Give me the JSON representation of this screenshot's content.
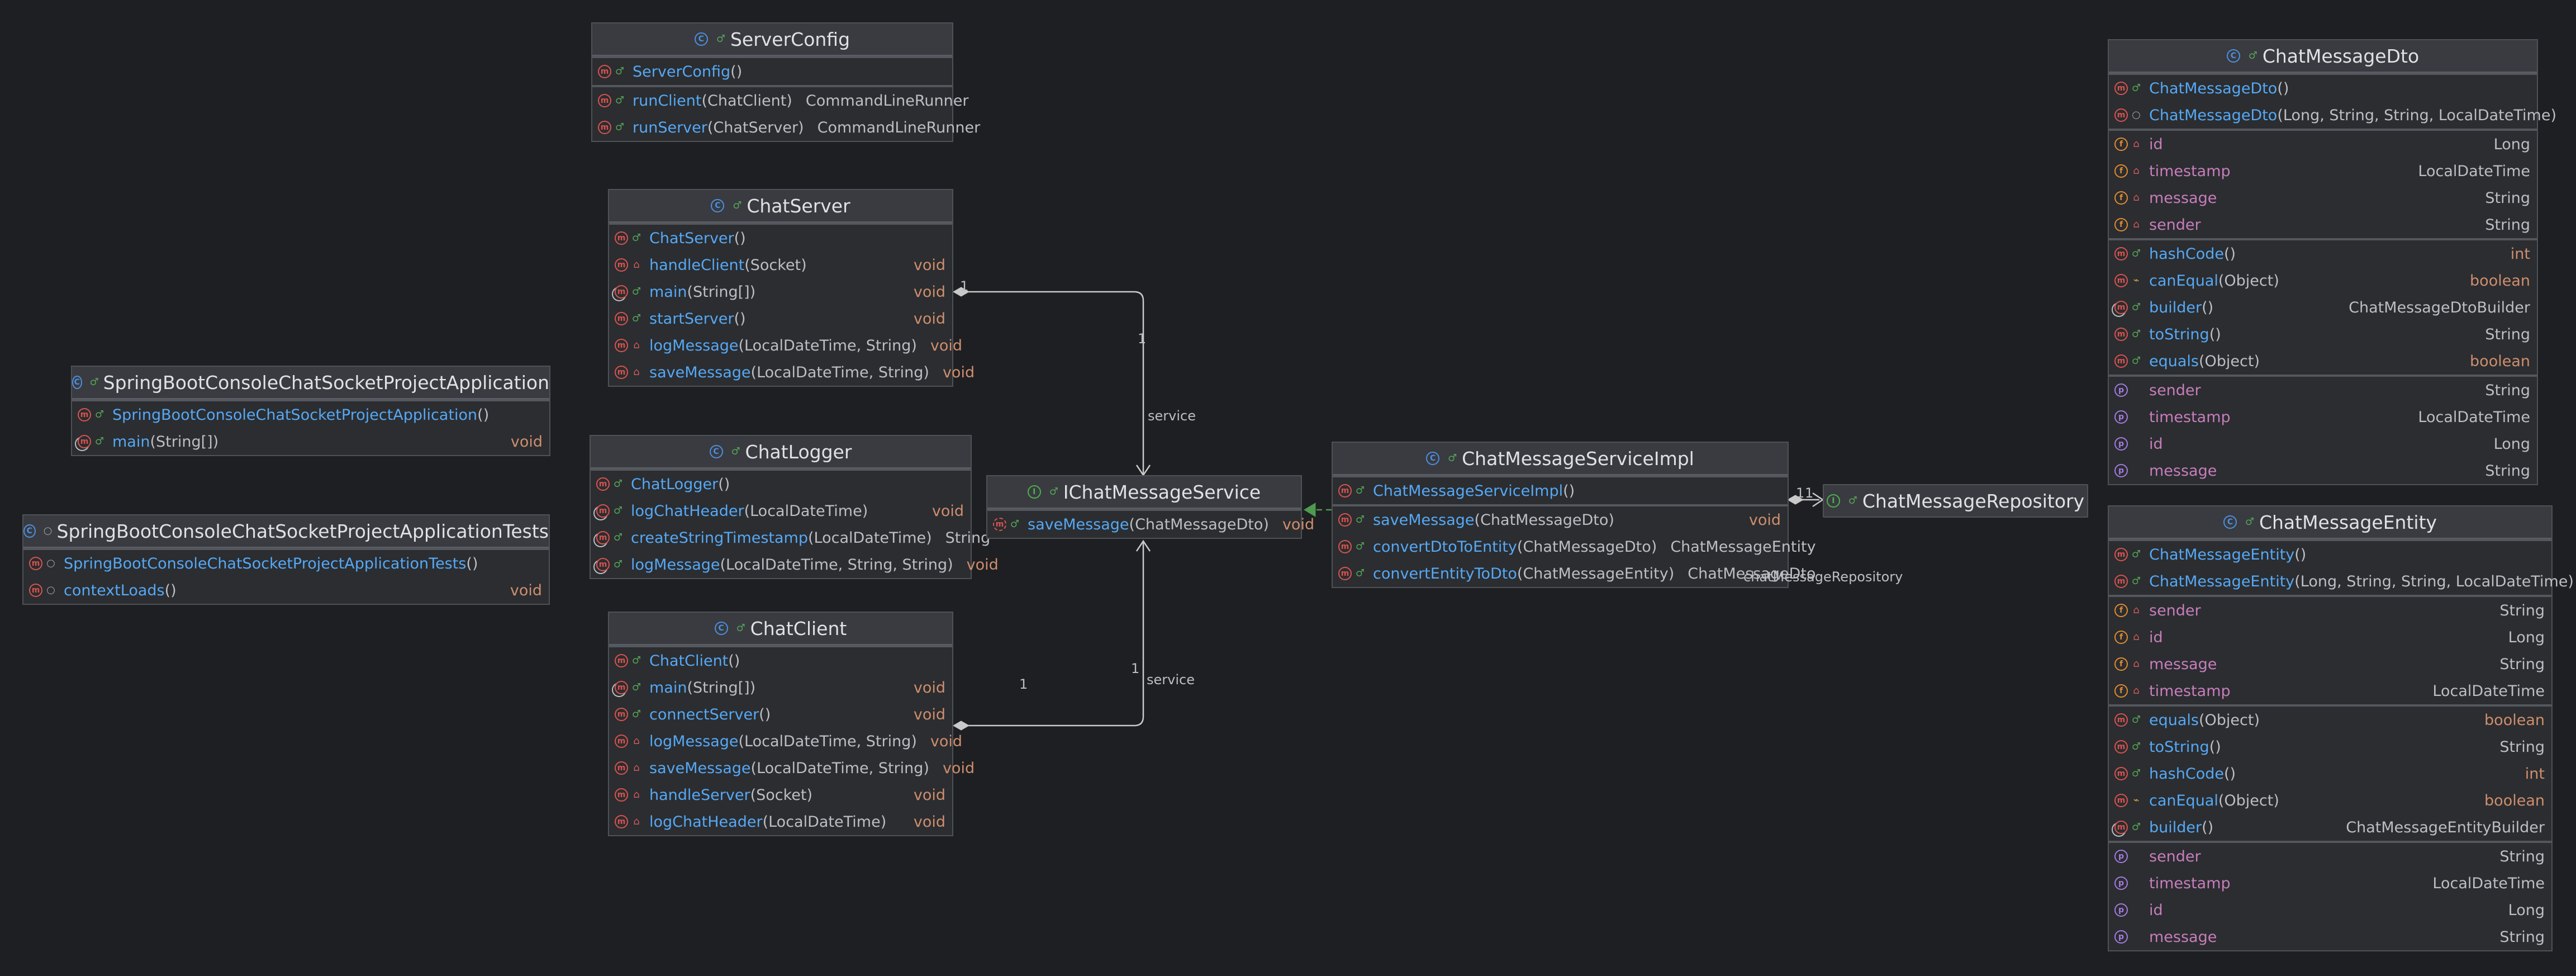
{
  "colors": {
    "background": "#1e1f22",
    "node_body": "#2b2d30",
    "node_header": "#393b40",
    "method_name": "#56a8f5",
    "field_name": "#c77dbb",
    "keyword_type": "#cf8e6d",
    "edge": "#c9c9c9",
    "realization_edge": "#4e9a4e"
  },
  "icons": {
    "class": "class-icon",
    "interface": "interface-icon",
    "method": "method-icon",
    "field": "field-icon",
    "property": "property-icon",
    "public": "unlock-icon",
    "private": "lock-icon",
    "package_private": "circle-icon",
    "protected": "key-icon",
    "static": "static-overlay-icon"
  },
  "nodes": [
    {
      "id": "server-config",
      "title": "ServerConfig",
      "kind": "class",
      "sections": [
        [
          {
            "icon": "method",
            "name": "ServerConfig",
            "params": "()",
            "type": ""
          }
        ],
        [
          {
            "icon": "method",
            "name": "runClient",
            "params": "(ChatClient)",
            "type": "CommandLineRunner"
          },
          {
            "icon": "method",
            "name": "runServer",
            "params": "(ChatServer)",
            "type": "CommandLineRunner"
          }
        ]
      ]
    },
    {
      "id": "chat-server",
      "title": "ChatServer",
      "kind": "class",
      "sections": [
        [
          {
            "icon": "method",
            "name": "ChatServer",
            "params": "()",
            "type": ""
          },
          {
            "icon": "method",
            "vis": "private",
            "name": "handleClient",
            "params": "(Socket)",
            "type": "void"
          },
          {
            "icon": "method",
            "static": true,
            "name": "main",
            "params": "(String[])",
            "type": "void"
          },
          {
            "icon": "method",
            "name": "startServer",
            "params": "()",
            "type": "void"
          },
          {
            "icon": "method",
            "vis": "private",
            "name": "logMessage",
            "params": "(LocalDateTime, String)",
            "type": "void"
          },
          {
            "icon": "method",
            "vis": "private",
            "name": "saveMessage",
            "params": "(LocalDateTime, String)",
            "type": "void"
          }
        ]
      ]
    },
    {
      "id": "app",
      "title": "SpringBootConsoleChatSocketProjectApplication",
      "kind": "class",
      "sections": [
        [
          {
            "icon": "method",
            "name": "SpringBootConsoleChatSocketProjectApplication",
            "params": "()",
            "type": ""
          },
          {
            "icon": "method",
            "static": true,
            "name": "main",
            "params": "(String[])",
            "type": "void"
          }
        ]
      ]
    },
    {
      "id": "chat-logger",
      "title": "ChatLogger",
      "kind": "class",
      "sections": [
        [
          {
            "icon": "method",
            "name": "ChatLogger",
            "params": "()",
            "type": ""
          },
          {
            "icon": "method",
            "static": true,
            "name": "logChatHeader",
            "params": "(LocalDateTime)",
            "type": "void"
          },
          {
            "icon": "method",
            "static": true,
            "name": "createStringTimestamp",
            "params": "(LocalDateTime)",
            "type": "String"
          },
          {
            "icon": "method",
            "static": true,
            "name": "logMessage",
            "params": "(LocalDateTime, String, String)",
            "type": "void"
          }
        ]
      ]
    },
    {
      "id": "app-tests",
      "title": "SpringBootConsoleChatSocketProjectApplicationTests",
      "kind": "class",
      "vis": "package",
      "sections": [
        [
          {
            "icon": "method",
            "vis": "package",
            "name": "SpringBootConsoleChatSocketProjectApplicationTests",
            "params": "()",
            "type": ""
          },
          {
            "icon": "method",
            "vis": "package",
            "name": "contextLoads",
            "params": "()",
            "type": "void"
          }
        ]
      ]
    },
    {
      "id": "chat-client",
      "title": "ChatClient",
      "kind": "class",
      "sections": [
        [
          {
            "icon": "method",
            "name": "ChatClient",
            "params": "()",
            "type": ""
          },
          {
            "icon": "method",
            "static": true,
            "name": "main",
            "params": "(String[])",
            "type": "void"
          },
          {
            "icon": "method",
            "name": "connectServer",
            "params": "()",
            "type": "void"
          },
          {
            "icon": "method",
            "vis": "private",
            "name": "logMessage",
            "params": "(LocalDateTime, String)",
            "type": "void"
          },
          {
            "icon": "method",
            "vis": "private",
            "name": "saveMessage",
            "params": "(LocalDateTime, String)",
            "type": "void"
          },
          {
            "icon": "method",
            "vis": "private",
            "name": "handleServer",
            "params": "(Socket)",
            "type": "void"
          },
          {
            "icon": "method",
            "vis": "private",
            "name": "logChatHeader",
            "params": "(LocalDateTime)",
            "type": "void"
          }
        ]
      ]
    },
    {
      "id": "ichat-message-service",
      "title": "IChatMessageService",
      "kind": "interface",
      "sections": [
        [
          {
            "icon": "method",
            "abstract": true,
            "name": "saveMessage",
            "params": "(ChatMessageDto)",
            "type": "void"
          }
        ]
      ]
    },
    {
      "id": "chat-message-service-impl",
      "title": "ChatMessageServiceImpl",
      "kind": "class",
      "sections": [
        [
          {
            "icon": "method",
            "name": "ChatMessageServiceImpl",
            "params": "()",
            "type": ""
          }
        ],
        [
          {
            "icon": "method",
            "name": "saveMessage",
            "params": "(ChatMessageDto)",
            "type": "void"
          },
          {
            "icon": "method",
            "name": "convertDtoToEntity",
            "params": "(ChatMessageDto)",
            "type": "ChatMessageEntity"
          },
          {
            "icon": "method",
            "name": "convertEntityToDto",
            "params": "(ChatMessageEntity)",
            "type": "ChatMessageDto"
          }
        ]
      ]
    },
    {
      "id": "chat-message-repository",
      "title": "ChatMessageRepository",
      "kind": "interface",
      "sections": []
    },
    {
      "id": "chat-message-dto",
      "title": "ChatMessageDto",
      "kind": "class",
      "sections": [
        [
          {
            "icon": "method",
            "name": "ChatMessageDto",
            "params": "()",
            "type": ""
          },
          {
            "icon": "method",
            "vis": "package",
            "name": "ChatMessageDto",
            "params": "(Long, String, String, LocalDateTime)",
            "type": ""
          }
        ],
        [
          {
            "icon": "field",
            "vis": "private",
            "name": "id",
            "type": "Long"
          },
          {
            "icon": "field",
            "vis": "private",
            "name": "timestamp",
            "type": "LocalDateTime"
          },
          {
            "icon": "field",
            "vis": "private",
            "name": "message",
            "type": "String"
          },
          {
            "icon": "field",
            "vis": "private",
            "name": "sender",
            "type": "String"
          }
        ],
        [
          {
            "icon": "method",
            "name": "hashCode",
            "params": "()",
            "type": "int"
          },
          {
            "icon": "method",
            "vis": "protected",
            "name": "canEqual",
            "params": "(Object)",
            "type": "boolean"
          },
          {
            "icon": "method",
            "static": true,
            "name": "builder",
            "params": "()",
            "type": "ChatMessageDtoBuilder"
          },
          {
            "icon": "method",
            "name": "toString",
            "params": "()",
            "type": "String"
          },
          {
            "icon": "method",
            "name": "equals",
            "params": "(Object)",
            "type": "boolean"
          }
        ],
        [
          {
            "icon": "property",
            "name": "sender",
            "type": "String"
          },
          {
            "icon": "property",
            "name": "timestamp",
            "type": "LocalDateTime"
          },
          {
            "icon": "property",
            "name": "id",
            "type": "Long"
          },
          {
            "icon": "property",
            "name": "message",
            "type": "String"
          }
        ]
      ]
    },
    {
      "id": "chat-message-entity",
      "title": "ChatMessageEntity",
      "kind": "class",
      "sections": [
        [
          {
            "icon": "method",
            "name": "ChatMessageEntity",
            "params": "()",
            "type": ""
          },
          {
            "icon": "method",
            "name": "ChatMessageEntity",
            "params": "(Long, String, String, LocalDateTime)",
            "type": ""
          }
        ],
        [
          {
            "icon": "field",
            "vis": "private",
            "name": "sender",
            "type": "String"
          },
          {
            "icon": "field",
            "vis": "private",
            "name": "id",
            "type": "Long"
          },
          {
            "icon": "field",
            "vis": "private",
            "name": "message",
            "type": "String"
          },
          {
            "icon": "field",
            "vis": "private",
            "name": "timestamp",
            "type": "LocalDateTime"
          }
        ],
        [
          {
            "icon": "method",
            "name": "equals",
            "params": "(Object)",
            "type": "boolean"
          },
          {
            "icon": "method",
            "name": "toString",
            "params": "()",
            "type": "String"
          },
          {
            "icon": "method",
            "name": "hashCode",
            "params": "()",
            "type": "int"
          },
          {
            "icon": "method",
            "vis": "protected",
            "name": "canEqual",
            "params": "(Object)",
            "type": "boolean"
          },
          {
            "icon": "method",
            "static": true,
            "name": "builder",
            "params": "()",
            "type": "ChatMessageEntityBuilder"
          }
        ],
        [
          {
            "icon": "property",
            "name": "sender",
            "type": "String"
          },
          {
            "icon": "property",
            "name": "timestamp",
            "type": "LocalDateTime"
          },
          {
            "icon": "property",
            "name": "id",
            "type": "Long"
          },
          {
            "icon": "property",
            "name": "message",
            "type": "String"
          }
        ]
      ]
    }
  ],
  "edges": [
    {
      "id": "chat-server-to-service",
      "from": "chat-server",
      "to": "ichat-message-service",
      "kind": "composition",
      "role": "service",
      "source_multiplicity": "1",
      "target_multiplicity": "1"
    },
    {
      "id": "chat-client-to-service",
      "from": "chat-client",
      "to": "ichat-message-service",
      "kind": "composition",
      "role": "service",
      "source_multiplicity": "1",
      "target_multiplicity": "1"
    },
    {
      "id": "impl-realizes-service",
      "from": "chat-message-service-impl",
      "to": "ichat-message-service",
      "kind": "realization"
    },
    {
      "id": "impl-to-repository",
      "from": "chat-message-service-impl",
      "to": "chat-message-repository",
      "kind": "composition",
      "role": "chatMessageRepository",
      "source_multiplicity": "1",
      "target_multiplicity": "1"
    }
  ]
}
